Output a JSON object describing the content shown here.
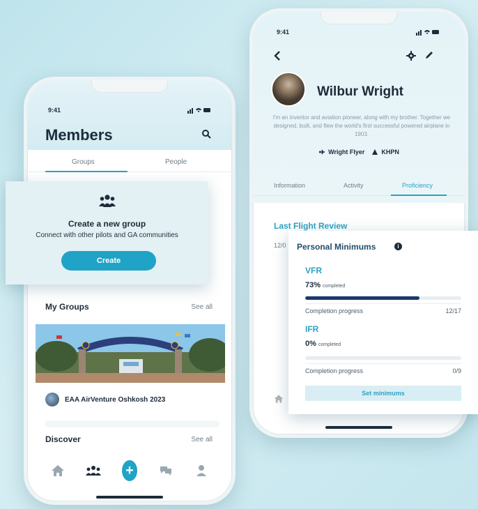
{
  "left_phone": {
    "status_time": "9:41",
    "title": "Members",
    "tabs": [
      {
        "label": "Groups",
        "active": true
      },
      {
        "label": "People",
        "active": false
      }
    ],
    "my_groups": {
      "title": "My Groups",
      "see_all": "See all",
      "items": [
        {
          "name": "EAA AirVenture Oshkosh 2023"
        }
      ]
    },
    "discover": {
      "title": "Discover",
      "see_all": "See all"
    },
    "bottom_nav": [
      "home-icon",
      "group-icon",
      "plus-icon",
      "chat-icon",
      "person-icon"
    ]
  },
  "create_group_card": {
    "icon": "group-icon",
    "title": "Create a new group",
    "subtitle": "Connect with other pilots and GA communities",
    "button_label": "Create"
  },
  "right_phone": {
    "status_time": "9:41",
    "profile": {
      "name": "Wilbur Wright",
      "bio": "I'm an inventor and aviation pioneer, along with my brother. Together we designed, built, and flew the world's first successful powered airplane in 1903.",
      "aircraft": "Wright Flyer",
      "airport": "KHPN"
    },
    "tabs": [
      {
        "label": "Information",
        "active": false
      },
      {
        "label": "Activity",
        "active": false
      },
      {
        "label": "Proficiency",
        "active": true
      }
    ],
    "last_flight_review": {
      "title": "Last Flight Review",
      "date": "12/0"
    }
  },
  "personal_minimums": {
    "title": "Personal Minimums",
    "categories": [
      {
        "label": "VFR",
        "percent_text": "73%",
        "percent_suffix": "completed",
        "progress": 0.73,
        "progress_label": "Completion progress",
        "count": "12/17"
      },
      {
        "label": "IFR",
        "percent_text": "0%",
        "percent_suffix": "completed",
        "progress": 0.0,
        "progress_label": "Completion progress",
        "count": "0/9"
      }
    ],
    "button_label": "Set minimums"
  },
  "colors": {
    "accent": "#1fa3c6",
    "progress_fill": "#1a3a6a",
    "background": "#c9e9f0"
  }
}
